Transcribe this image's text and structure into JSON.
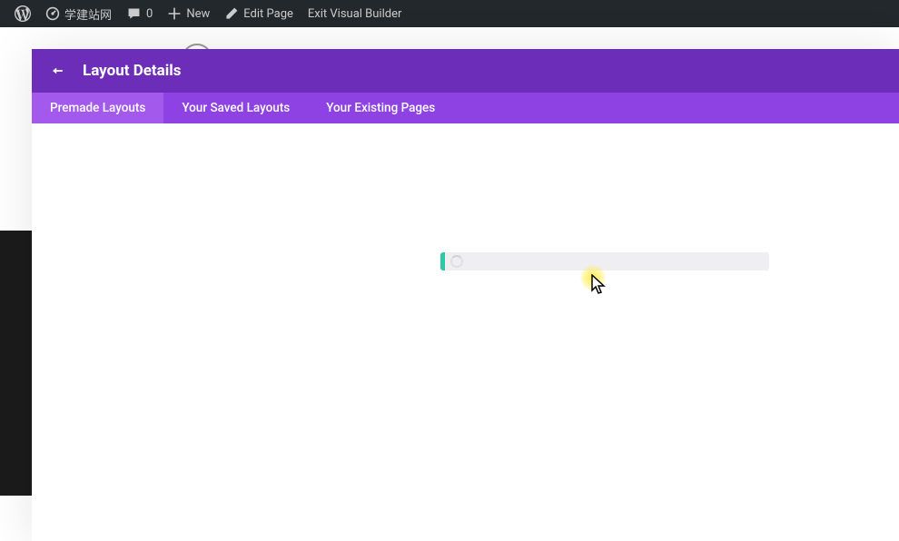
{
  "admin_bar": {
    "site_name": "学建站网",
    "comments_count": "0",
    "new_label": "New",
    "edit_page_label": "Edit Page",
    "exit_vb_label": "Exit Visual Builder"
  },
  "modal": {
    "title": "Layout Details",
    "tabs": {
      "premade": "Premade Layouts",
      "saved": "Your Saved Layouts",
      "existing": "Your Existing Pages"
    }
  },
  "icons": {
    "wp": "wordpress-icon",
    "dashboard": "dashboard-icon",
    "comment": "comment-icon",
    "plus": "plus-icon",
    "pencil": "pencil-icon"
  }
}
